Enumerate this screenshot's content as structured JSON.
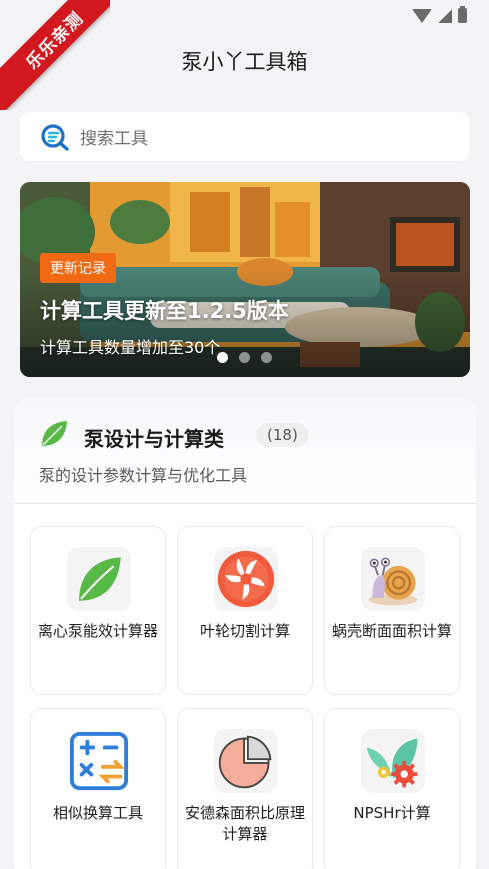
{
  "ribbon": {
    "text": "乐乐亲测"
  },
  "header": {
    "title": "泵小丫工具箱"
  },
  "search": {
    "placeholder": "搜索工具"
  },
  "banner": {
    "tag": "更新记录",
    "title": "计算工具更新至1.2.5版本",
    "subtitle": "计算工具数量增加至30个",
    "pages": 3,
    "active_page": 1
  },
  "category": {
    "title": "泵设计与计算类",
    "count": "(18)",
    "description": "泵的设计参数计算与优化工具",
    "tools": [
      {
        "label": "离心泵能效计算器",
        "icon": "leaf-icon"
      },
      {
        "label": "叶轮切割计算",
        "icon": "impeller-icon"
      },
      {
        "label": "蜗壳断面面积计算",
        "icon": "snail-icon"
      },
      {
        "label": "相似换算工具",
        "icon": "calculator-icon"
      },
      {
        "label": "安德森面积比原理计算器",
        "icon": "pie-chart-icon"
      },
      {
        "label": "NPSHr计算",
        "icon": "gear-leaf-icon"
      }
    ]
  },
  "colors": {
    "accent_orange": "#f26a14",
    "ribbon_red": "#d3191f",
    "leaf_green": "#58b947"
  }
}
